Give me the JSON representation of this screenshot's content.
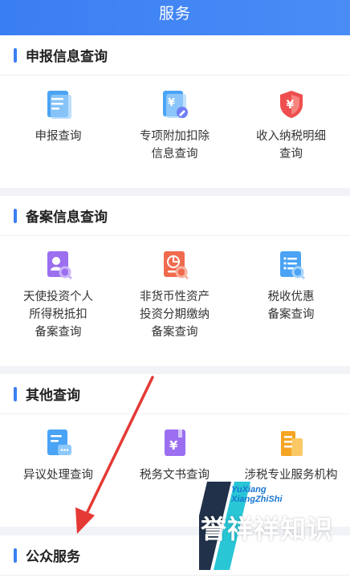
{
  "header": {
    "title": "服务"
  },
  "sections": [
    {
      "title": "申报信息查询",
      "items": [
        {
          "label": "申报查询",
          "icon": "document-icon"
        },
        {
          "label": "专项附加扣除\n信息查询",
          "icon": "yen-document-icon"
        },
        {
          "label": "收入纳税明细\n查询",
          "icon": "yen-shield-icon"
        }
      ]
    },
    {
      "title": "备案信息查询",
      "items": [
        {
          "label": "天使投资个人\n所得税抵扣\n备案查询",
          "icon": "person-search-icon"
        },
        {
          "label": "非货币性资产\n投资分期缴纳\n备案查询",
          "icon": "chart-search-icon"
        },
        {
          "label": "税收优惠\n备案查询",
          "icon": "list-search-icon"
        }
      ]
    },
    {
      "title": "其他查询",
      "items": [
        {
          "label": "异议处理查询",
          "icon": "message-document-icon"
        },
        {
          "label": "税务文书查询",
          "icon": "yen-book-icon"
        },
        {
          "label": "涉税专业服务机构",
          "icon": "building-icon"
        }
      ]
    },
    {
      "title": "公众服务",
      "items": []
    }
  ],
  "watermark": {
    "en_line1": "YuXiang",
    "en_line2": "XiangZhiShi",
    "main": "誉祥祥知识"
  },
  "colors": {
    "accent": "#3b7ff1",
    "header_bg": "#3a7ef3",
    "arrow": "#e53935"
  }
}
